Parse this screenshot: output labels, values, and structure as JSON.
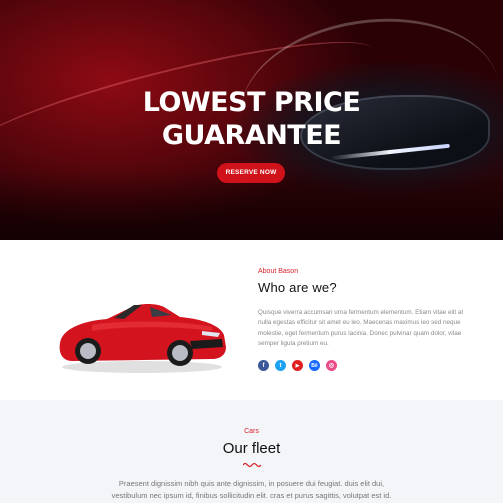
{
  "hero": {
    "headline_line1": "LOWEST PRICE",
    "headline_line2": "GUARANTEE",
    "cta_label": "RESERVE NOW",
    "accent_color": "#d0121a"
  },
  "about": {
    "eyebrow": "About Bason",
    "title": "Who are we?",
    "body": "Quisque viverra accumsan urna fermentum elementum. Etiam vitae elit at nulla egestas efficitur sit amet eu leo. Maecenas maximus leo sed neque molestie, eget fermentum purus lacinia. Donec pulvinar quam dolor, vitae semper ligula pretium eu.",
    "social": [
      {
        "icon": "facebook-icon",
        "glyph": "f",
        "color": "#3b5998"
      },
      {
        "icon": "twitter-icon",
        "glyph": "t",
        "color": "#1da1f2"
      },
      {
        "icon": "youtube-icon",
        "glyph": "▶",
        "color": "#e02020"
      },
      {
        "icon": "behance-icon",
        "glyph": "Bē",
        "color": "#1769ff"
      },
      {
        "icon": "dribbble-icon",
        "glyph": "◎",
        "color": "#ea4c89"
      }
    ]
  },
  "fleet": {
    "eyebrow": "Cars",
    "title": "Our fleet",
    "body_line1": "Praesent dignissim nibh quis ante dignissim, in posuere dui feugiat. duis elit dui,",
    "body_line2": "vestibulum nec ipsum id, finibus sollicitudin elit. cras et purus sagittis, volutpat est id."
  }
}
